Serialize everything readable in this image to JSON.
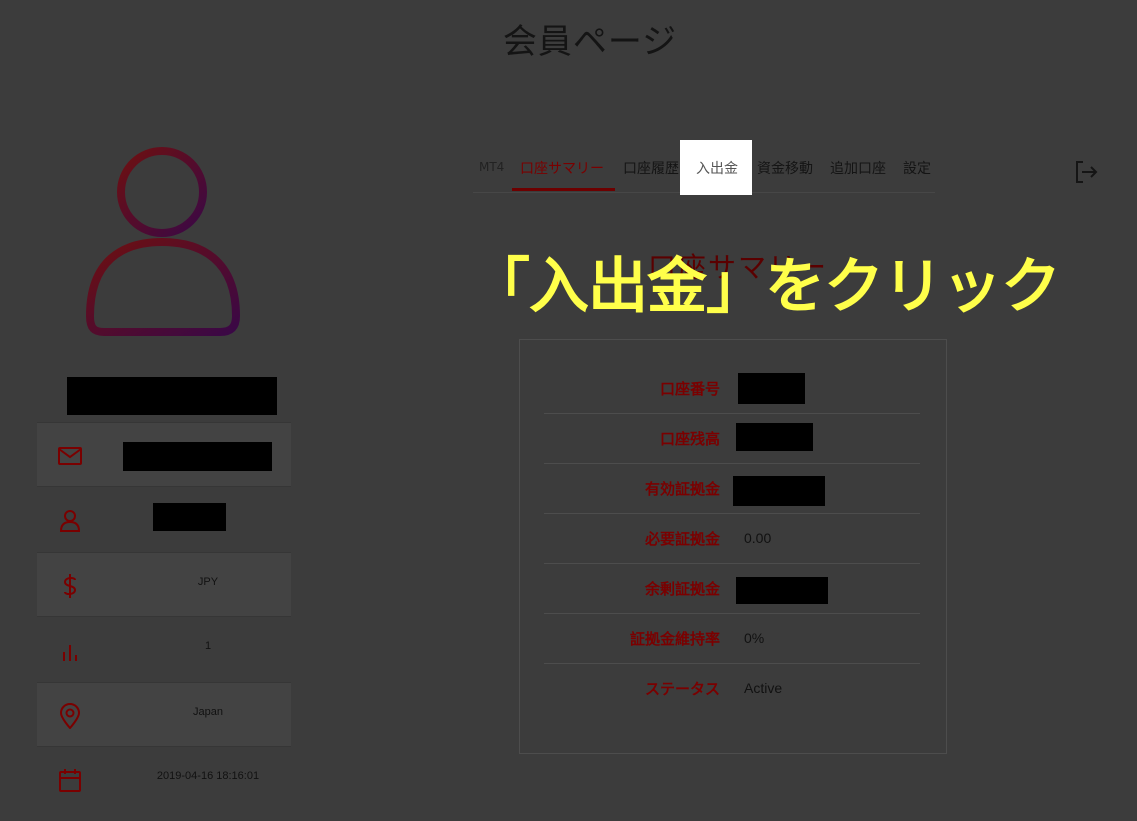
{
  "page": {
    "title": "会員ページ"
  },
  "profile": {
    "info": [
      {
        "icon": "mail-icon",
        "value": ""
      },
      {
        "icon": "user-icon",
        "value": ""
      },
      {
        "icon": "dollar-icon",
        "value": "JPY"
      },
      {
        "icon": "bar-chart-icon",
        "value": "1"
      },
      {
        "icon": "location-pin-icon",
        "value": "Japan"
      },
      {
        "icon": "calendar-icon",
        "value": "2019-04-16 18:16:01"
      }
    ]
  },
  "tabs": [
    {
      "label": "MT4",
      "active": false
    },
    {
      "label": "口座サマリー",
      "active": true
    },
    {
      "label": "口座履歴",
      "active": false
    },
    {
      "label": "入出金",
      "active": false,
      "highlighted": true
    },
    {
      "label": "資金移動",
      "active": false
    },
    {
      "label": "追加口座",
      "active": false
    },
    {
      "label": "設定",
      "active": false
    }
  ],
  "section": {
    "title": "口座サマリー"
  },
  "callout": {
    "text": "「入出金」をクリック",
    "color": "#ffff4a"
  },
  "summary": [
    {
      "label": "口座番号",
      "value": ""
    },
    {
      "label": "口座残高",
      "value": ""
    },
    {
      "label": "有効証拠金",
      "value": ""
    },
    {
      "label": "必要証拠金",
      "value": "0.00"
    },
    {
      "label": "余剰証拠金",
      "value": ""
    },
    {
      "label": "証拠金維持率",
      "value": "0%"
    },
    {
      "label": "ステータス",
      "value": "Active"
    }
  ],
  "colors": {
    "accent": "#7a0000",
    "overlay": "#3c3c3c",
    "highlight": "#ffffff"
  }
}
